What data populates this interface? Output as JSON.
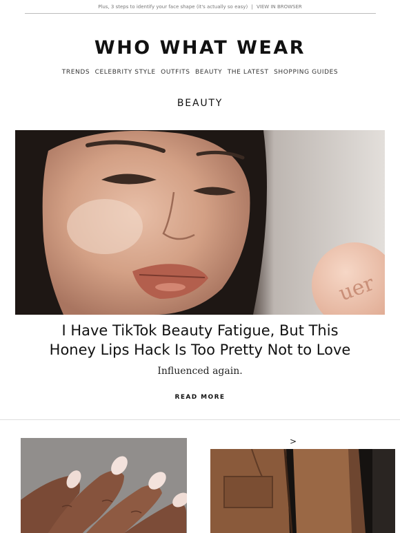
{
  "preheader": {
    "text": "Plus, 3 steps to identify your face shape (it's actually so easy)",
    "separator": "|",
    "view_in_browser": "VIEW IN BROWSER"
  },
  "brand": {
    "logo": "WHO WHAT WEAR"
  },
  "nav": {
    "items": [
      "TRENDS",
      "CELEBRITY STYLE",
      "OUTFITS",
      "BEAUTY",
      "THE LATEST",
      "SHOPPING GUIDES"
    ]
  },
  "section": {
    "title": "BEAUTY"
  },
  "feature": {
    "headline_line1": "I Have TikTok Beauty Fatigue, But This",
    "headline_line2": "Honey Lips Hack Is Too Pretty Not to Love",
    "dek": "Influenced again.",
    "cta": "READ MORE",
    "compact_text": "uer"
  },
  "secondary": {
    "arrow": ">"
  }
}
